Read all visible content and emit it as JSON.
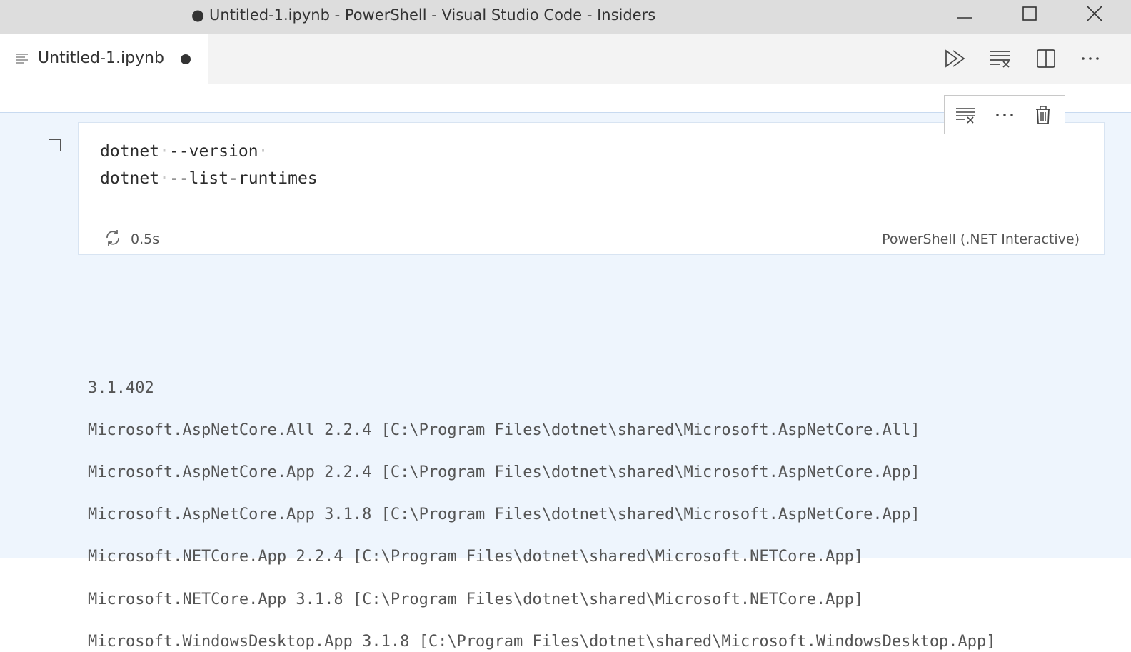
{
  "window": {
    "title": "● Untitled-1.ipynb - PowerShell - Visual Studio Code - Insiders",
    "icons": {
      "minimize": "minimize-icon",
      "maximize": "maximize-icon",
      "close": "close-icon"
    }
  },
  "tab": {
    "label": "Untitled-1.ipynb",
    "icon": "notebook-file-icon",
    "dirty": true
  },
  "editor_actions": [
    {
      "name": "run-all-icon"
    },
    {
      "name": "clear-all-outputs-icon"
    },
    {
      "name": "split-editor-icon"
    },
    {
      "name": "more-actions-icon"
    }
  ],
  "cell": {
    "code_lines": [
      [
        "dotnet",
        "--version"
      ],
      [
        "dotnet",
        "--list-runtimes"
      ]
    ],
    "exec_time": "0.5s",
    "kernel": "PowerShell (.NET Interactive)",
    "toolbar": [
      "clear-output-icon",
      "more-icon",
      "delete-icon"
    ]
  },
  "output": {
    "lines": [
      "3.1.402",
      "Microsoft.AspNetCore.All 2.2.4 [C:\\Program Files\\dotnet\\shared\\Microsoft.AspNetCore.All]",
      "Microsoft.AspNetCore.App 2.2.4 [C:\\Program Files\\dotnet\\shared\\Microsoft.AspNetCore.App]",
      "Microsoft.AspNetCore.App 3.1.8 [C:\\Program Files\\dotnet\\shared\\Microsoft.AspNetCore.App]",
      "Microsoft.NETCore.App 2.2.4 [C:\\Program Files\\dotnet\\shared\\Microsoft.NETCore.App]",
      "Microsoft.NETCore.App 3.1.8 [C:\\Program Files\\dotnet\\shared\\Microsoft.NETCore.App]",
      "Microsoft.WindowsDesktop.App 3.1.8 [C:\\Program Files\\dotnet\\shared\\Microsoft.WindowsDesktop.App]"
    ]
  }
}
